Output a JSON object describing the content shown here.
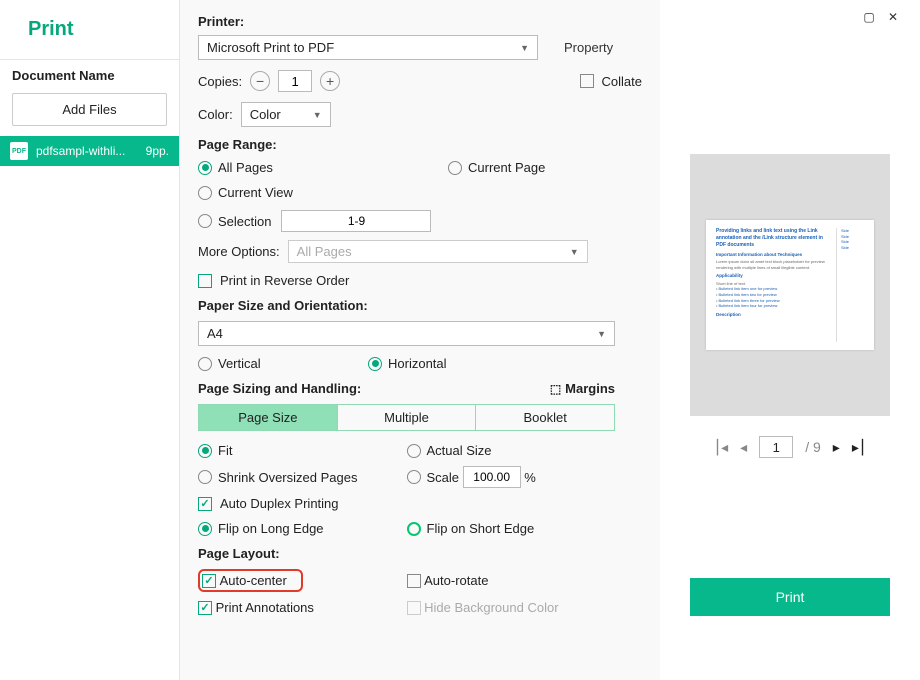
{
  "title": "Print",
  "left": {
    "doc_label": "Document Name",
    "add_files": "Add Files",
    "file_name": "pdfsampl-withli...",
    "file_pages": "9pp."
  },
  "printer": {
    "label": "Printer:",
    "value": "Microsoft Print to PDF",
    "property": "Property",
    "copies_label": "Copies:",
    "copies_value": "1",
    "collate": "Collate",
    "color_label": "Color:",
    "color_value": "Color"
  },
  "range": {
    "label": "Page Range:",
    "all": "All Pages",
    "current_page": "Current Page",
    "current_view": "Current View",
    "selection": "Selection",
    "selection_value": "1-9",
    "more_label": "More Options:",
    "more_value": "All Pages",
    "reverse": "Print in Reverse Order"
  },
  "paper": {
    "label": "Paper Size and Orientation:",
    "size": "A4",
    "vertical": "Vertical",
    "horizontal": "Horizontal"
  },
  "sizing": {
    "label": "Page Sizing and Handling:",
    "margins": "Margins",
    "tab_page_size": "Page Size",
    "tab_multiple": "Multiple",
    "tab_booklet": "Booklet",
    "fit": "Fit",
    "actual": "Actual Size",
    "shrink": "Shrink Oversized Pages",
    "scale": "Scale",
    "scale_value": "100.00",
    "scale_pct": "%",
    "duplex": "Auto Duplex Printing",
    "flip_long": "Flip on Long Edge",
    "flip_short": "Flip on Short Edge"
  },
  "layout": {
    "label": "Page Layout:",
    "auto_center": "Auto-center",
    "auto_rotate": "Auto-rotate",
    "annotations": "Print Annotations",
    "hide_bg": "Hide Background Color"
  },
  "preview": {
    "page_current": "1",
    "page_total": "/ 9",
    "print_button": "Print"
  }
}
